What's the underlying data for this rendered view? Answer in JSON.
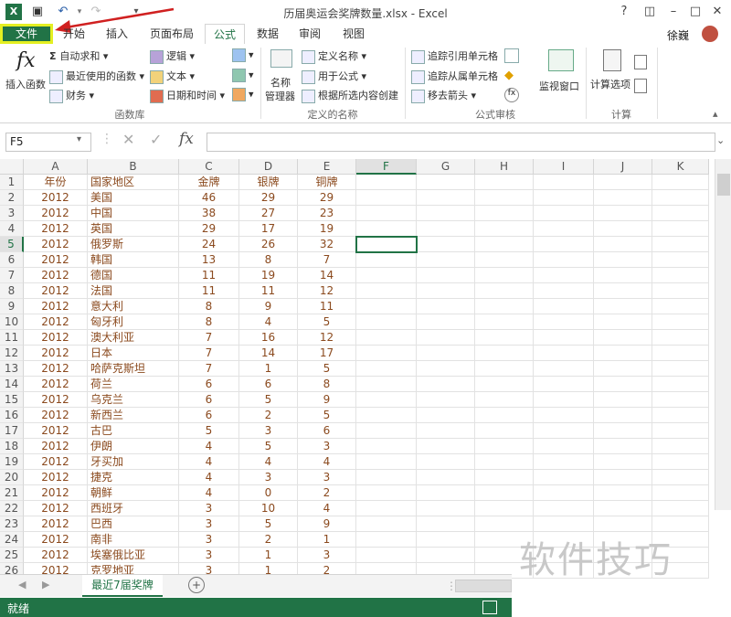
{
  "window": {
    "title": "历届奥运会奖牌数量.xlsx - Excel",
    "help_label": "?",
    "user_name": "徐巍"
  },
  "tabs": [
    {
      "label": "文件"
    },
    {
      "label": "开始"
    },
    {
      "label": "插入"
    },
    {
      "label": "页面布局"
    },
    {
      "label": "公式"
    },
    {
      "label": "数据"
    },
    {
      "label": "审阅"
    },
    {
      "label": "视图"
    }
  ],
  "ribbon": {
    "insert_function": "插入函数",
    "autosum": "自动求和",
    "recent": "最近使用的函数",
    "financial": "财务",
    "logical": "逻辑",
    "text": "文本",
    "datetime": "日期和时间",
    "group_library": "函数库",
    "name_manager_1": "名称",
    "name_manager_2": "管理器",
    "define_name": "定义名称",
    "use_in_formula": "用于公式",
    "create_from_sel": "根据所选内容创建",
    "group_names": "定义的名称",
    "trace_precedents": "追踪引用单元格",
    "trace_dependents": "追踪从属单元格",
    "remove_arrows": "移去箭头",
    "watch_window": "监视窗口",
    "group_audit": "公式审核",
    "calc_options": "计算选项",
    "group_calc": "计算"
  },
  "formula_bar": {
    "name_box": "F5",
    "fx": "fx",
    "value": ""
  },
  "columns": [
    "A",
    "B",
    "C",
    "D",
    "E",
    "F",
    "G",
    "H",
    "I",
    "J",
    "K"
  ],
  "selected_cell": "F5",
  "rows": [
    [
      "年份",
      "国家地区",
      "金牌",
      "银牌",
      "铜牌"
    ],
    [
      "2012",
      "美国",
      "46",
      "29",
      "29"
    ],
    [
      "2012",
      "中国",
      "38",
      "27",
      "23"
    ],
    [
      "2012",
      "英国",
      "29",
      "17",
      "19"
    ],
    [
      "2012",
      "俄罗斯",
      "24",
      "26",
      "32"
    ],
    [
      "2012",
      "韩国",
      "13",
      "8",
      "7"
    ],
    [
      "2012",
      "德国",
      "11",
      "19",
      "14"
    ],
    [
      "2012",
      "法国",
      "11",
      "11",
      "12"
    ],
    [
      "2012",
      "意大利",
      "8",
      "9",
      "11"
    ],
    [
      "2012",
      "匈牙利",
      "8",
      "4",
      "5"
    ],
    [
      "2012",
      "澳大利亚",
      "7",
      "16",
      "12"
    ],
    [
      "2012",
      "日本",
      "7",
      "14",
      "17"
    ],
    [
      "2012",
      "哈萨克斯坦",
      "7",
      "1",
      "5"
    ],
    [
      "2012",
      "荷兰",
      "6",
      "6",
      "8"
    ],
    [
      "2012",
      "乌克兰",
      "6",
      "5",
      "9"
    ],
    [
      "2012",
      "新西兰",
      "6",
      "2",
      "5"
    ],
    [
      "2012",
      "古巴",
      "5",
      "3",
      "6"
    ],
    [
      "2012",
      "伊朗",
      "4",
      "5",
      "3"
    ],
    [
      "2012",
      "牙买加",
      "4",
      "4",
      "4"
    ],
    [
      "2012",
      "捷克",
      "4",
      "3",
      "3"
    ],
    [
      "2012",
      "朝鲜",
      "4",
      "0",
      "2"
    ],
    [
      "2012",
      "西班牙",
      "3",
      "10",
      "4"
    ],
    [
      "2012",
      "巴西",
      "3",
      "5",
      "9"
    ],
    [
      "2012",
      "南非",
      "3",
      "2",
      "1"
    ],
    [
      "2012",
      "埃塞俄比亚",
      "3",
      "1",
      "3"
    ],
    [
      "2012",
      "克罗地亚",
      "3",
      "1",
      "2"
    ]
  ],
  "sheet_tab": "最近7届奖牌",
  "status": "就绪",
  "watermark": "软件技巧",
  "colors": {
    "accent": "#217346",
    "highlight": "#e4ef22",
    "cell_text": "#8b4a1e"
  }
}
